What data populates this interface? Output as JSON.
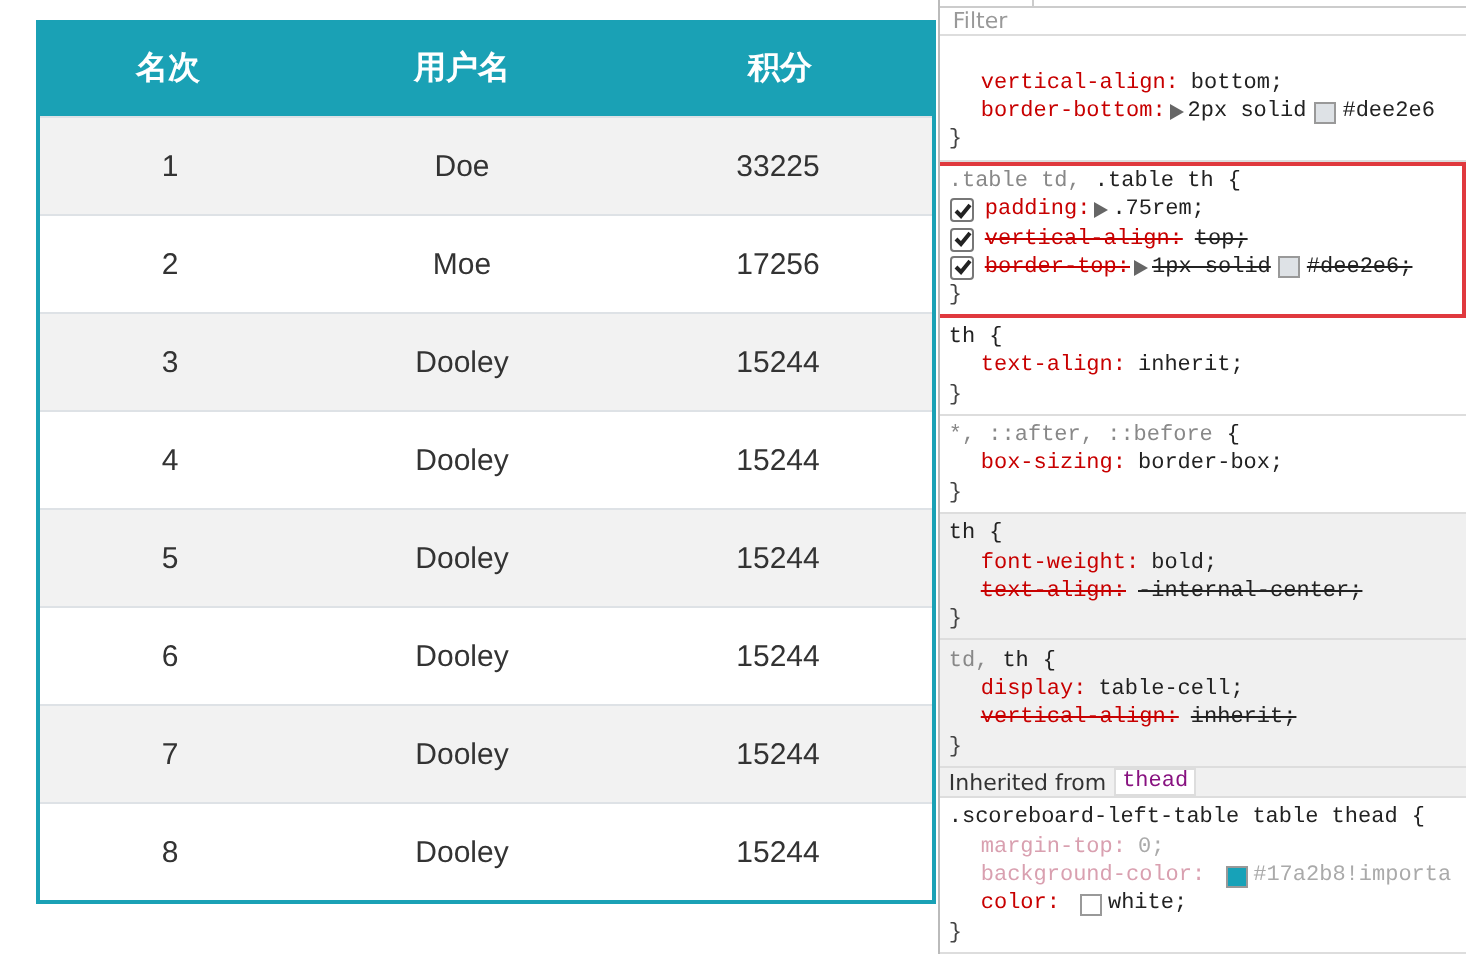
{
  "scoreboard": {
    "columns": [
      "名次",
      "用户名",
      "积分"
    ],
    "rows": [
      [
        "1",
        "Doe",
        "33225"
      ],
      [
        "2",
        "Moe",
        "17256"
      ],
      [
        "3",
        "Dooley",
        "15244"
      ],
      [
        "4",
        "Dooley",
        "15244"
      ],
      [
        "5",
        "Dooley",
        "15244"
      ],
      [
        "6",
        "Dooley",
        "15244"
      ],
      [
        "7",
        "Dooley",
        "15244"
      ],
      [
        "8",
        "Dooley",
        "15244"
      ]
    ]
  },
  "inspector": {
    "filter": {
      "placeholder": "Filter"
    },
    "rules": [
      {
        "user_agent": false,
        "highlighted": false,
        "declarations": [
          {
            "property": "vertical-align:",
            "value": "bottom;",
            "struck": false,
            "inactive": false,
            "expandable": false
          },
          {
            "property": "border-bottom:",
            "value_prefix": "2px solid",
            "color": "#dee2e6",
            "value": "#dee2e6",
            "struck": false,
            "inactive": false,
            "expandable": true
          }
        ],
        "close": "}"
      },
      {
        "selector": [
          {
            "text": ".table td,",
            "matched": false
          },
          {
            "text": ".table th",
            "matched": true
          },
          {
            "text": "{",
            "matched": true
          }
        ],
        "user_agent": false,
        "highlighted": true,
        "declarations": [
          {
            "property": "padding:",
            "value": ".75rem;",
            "struck": false,
            "inactive": false,
            "expandable": true,
            "checked": true
          },
          {
            "property": "vertical-align:",
            "value": "top;",
            "struck": true,
            "inactive": false,
            "expandable": false,
            "checked": true
          },
          {
            "property": "border-top:",
            "value_prefix": "1px solid",
            "color": "#dee2e6",
            "value": "#dee2e6;",
            "struck": true,
            "inactive": false,
            "expandable": true,
            "checked": true
          }
        ],
        "close": "}"
      },
      {
        "selector": [
          {
            "text": "th",
            "matched": true
          },
          {
            "text": "{",
            "matched": true
          }
        ],
        "user_agent": false,
        "highlighted": false,
        "declarations": [
          {
            "property": "text-align:",
            "value": "inherit;",
            "struck": false,
            "inactive": false,
            "expandable": false
          }
        ],
        "close": "}"
      },
      {
        "selector": [
          {
            "text": "*, ::after, ::before",
            "matched": false
          },
          {
            "text": "{",
            "matched": true
          }
        ],
        "user_agent": false,
        "highlighted": false,
        "declarations": [
          {
            "property": "box-sizing:",
            "value": "border-box;",
            "struck": false,
            "inactive": false,
            "expandable": false
          }
        ],
        "close": "}"
      },
      {
        "selector": [
          {
            "text": "th",
            "matched": true
          },
          {
            "text": "{",
            "matched": true
          }
        ],
        "user_agent": true,
        "highlighted": false,
        "declarations": [
          {
            "property": "font-weight:",
            "value": "bold;",
            "struck": false,
            "inactive": false,
            "expandable": false
          },
          {
            "property": "text-align:",
            "value": "-internal-center;",
            "struck": true,
            "inactive": false,
            "expandable": false
          }
        ],
        "close": "}"
      },
      {
        "selector": [
          {
            "text": "td,",
            "matched": false
          },
          {
            "text": "th",
            "matched": true
          },
          {
            "text": "{",
            "matched": true
          }
        ],
        "user_agent": true,
        "highlighted": false,
        "declarations": [
          {
            "property": "display:",
            "value": "table-cell;",
            "struck": false,
            "inactive": false,
            "expandable": false
          },
          {
            "property": "vertical-align:",
            "value": "inherit;",
            "struck": true,
            "inactive": false,
            "expandable": false
          }
        ],
        "close": "}"
      },
      {
        "inherited_label": "Inherited from",
        "inherited_element": "thead",
        "selector": [
          {
            "text": ".scoreboard-left-table table thead",
            "matched": true
          },
          {
            "text": "{",
            "matched": true
          }
        ],
        "user_agent": false,
        "highlighted": false,
        "declarations": [
          {
            "property": "margin-top:",
            "value": "0;",
            "struck": false,
            "inactive": true,
            "expandable": false
          },
          {
            "property": "background-color:",
            "color": "#17a2b8",
            "value": "#17a2b8!importa",
            "struck": false,
            "inactive": true,
            "expandable": false
          },
          {
            "property": "color:",
            "color": "#ffffff",
            "value": "white;",
            "struck": false,
            "inactive": false,
            "expandable": false
          }
        ],
        "close": "}"
      }
    ]
  }
}
